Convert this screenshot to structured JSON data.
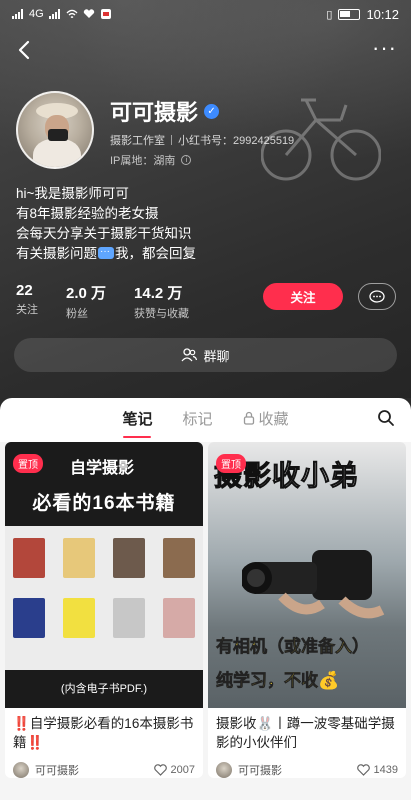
{
  "status_bar": {
    "time": "10:12",
    "signal_text": "4G",
    "battery": "battery-icon"
  },
  "nav": {
    "back": "back-icon",
    "more": "···"
  },
  "profile": {
    "name": "可可摄影",
    "verified": "verified-icon",
    "org": "摄影工作室",
    "id_label": "小红书号：2992425519",
    "ip_label": "IP属地：湖南",
    "bio": [
      "hi~我是摄影师可可",
      "有8年摄影经验的老女摄",
      "会每天分享关于摄影干货知识"
    ],
    "bio_last_a": "有关摄影问题",
    "bio_last_b": "我，都会回复"
  },
  "stats": [
    {
      "num": "22",
      "label": "关注"
    },
    {
      "num": "2.0 万",
      "label": "粉丝"
    },
    {
      "num": "14.2 万",
      "label": "获赞与收藏"
    }
  ],
  "actions": {
    "follow": "关注",
    "group_chat": "群聊"
  },
  "tabs": {
    "notes": "笔记",
    "marks": "标记",
    "saved": "收藏"
  },
  "colors": {
    "accent": "#ff2e4d",
    "verified": "#3d8bff"
  },
  "posts": [
    {
      "pin": "置顶",
      "cover_line1": "自学摄影",
      "cover_line2": "必看的16本书籍",
      "cover_bottom": "(内含电子书PDF.)",
      "title_prefix": "‼️",
      "title": "自学摄影必看的16本摄影书籍",
      "title_suffix": "‼️",
      "author": "可可摄影",
      "likes": "2007"
    },
    {
      "pin": "置顶",
      "cover_big": "摄影收小弟",
      "cover_y1": "有相机（或准备入）",
      "cover_y2": "纯学习，不收💰",
      "title": "摄影收🐰丨蹲一波零基础学摄影的小伙伴们",
      "author": "可可摄影",
      "likes": "1439"
    }
  ]
}
